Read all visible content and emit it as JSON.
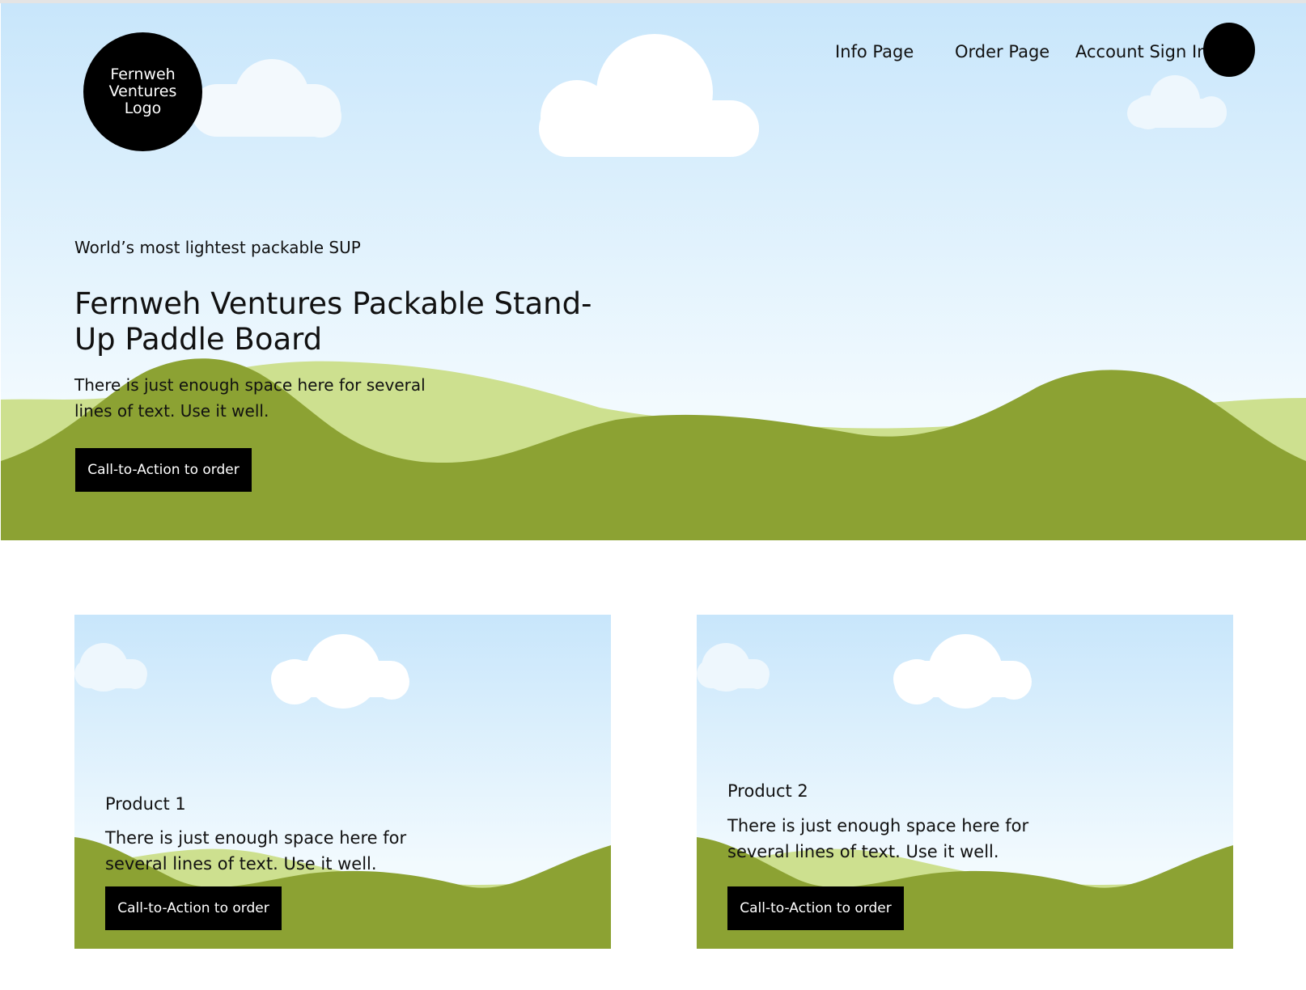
{
  "header": {
    "logo_text": "Fernweh Ventures Logo",
    "nav": [
      {
        "label": "Info Page"
      },
      {
        "label": "Order Page"
      },
      {
        "label": "Account Sign In"
      }
    ]
  },
  "hero": {
    "eyebrow": "World’s most lightest packable SUP",
    "title": "Fernweh Ventures Packable Stand-Up Paddle Board",
    "body": "There is just enough space here for several lines of text. Use it well.",
    "cta_label": "Call-to-Action to order"
  },
  "products": [
    {
      "title": "Product 1",
      "body": "There is just enough space here for several lines of text. Use it well.",
      "cta_label": "Call-to-Action to order"
    },
    {
      "title": "Product 2",
      "body": "There is just enough space here for several lines of text. Use it well.",
      "cta_label": "Call-to-Action to order"
    }
  ],
  "colors": {
    "sky_top": "#c8e6fb",
    "sky_bottom": "#f2fafe",
    "hill_light": "#cde08f",
    "hill_dark": "#8ca233",
    "button_bg": "#000000",
    "button_text": "#ffffff"
  }
}
